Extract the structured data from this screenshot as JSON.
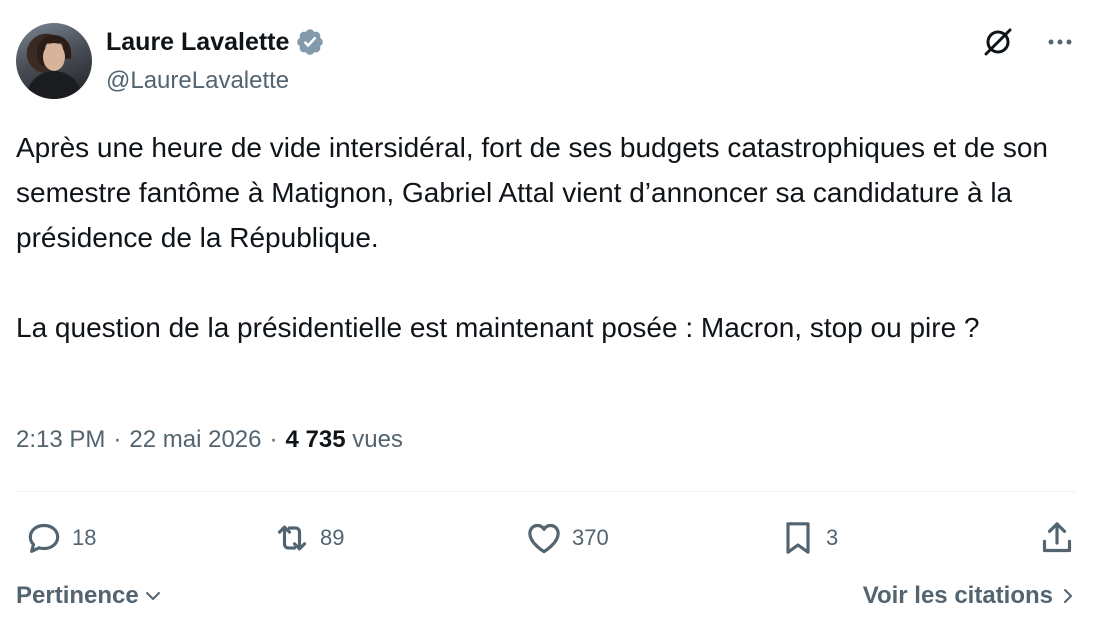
{
  "author": {
    "name": "Laure Lavalette",
    "handle": "@LaureLavalette",
    "verified_color": "#829aab"
  },
  "tweet": {
    "paragraphs": [
      "Après une heure de vide intersidéral, fort de ses budgets catastrophiques et de son semestre fantôme à Matignon, Gabriel Attal vient d’annoncer sa candidature à la présidence de la République.",
      "La question de la présidentielle est maintenant posée : Macron, stop ou pire ?"
    ],
    "time": "2:13 PM",
    "separator": "·",
    "date": "22 mai 2026",
    "views_count": "4 735",
    "views_label": "vues"
  },
  "actions": {
    "replies": "18",
    "reposts": "89",
    "likes": "370",
    "bookmarks": "3"
  },
  "footer": {
    "sort_label": "Pertinence",
    "quotes_label": "Voir les citations"
  },
  "icons": {
    "header": [
      "grok-icon",
      "more-icon"
    ],
    "actions": [
      "reply-icon",
      "repost-icon",
      "like-icon",
      "bookmark-icon",
      "share-icon"
    ],
    "footer": [
      "chevron-down-icon",
      "chevron-right-icon"
    ]
  },
  "colors": {
    "text": "#0f1419",
    "secondary": "#536471",
    "divider": "#eff3f4"
  }
}
